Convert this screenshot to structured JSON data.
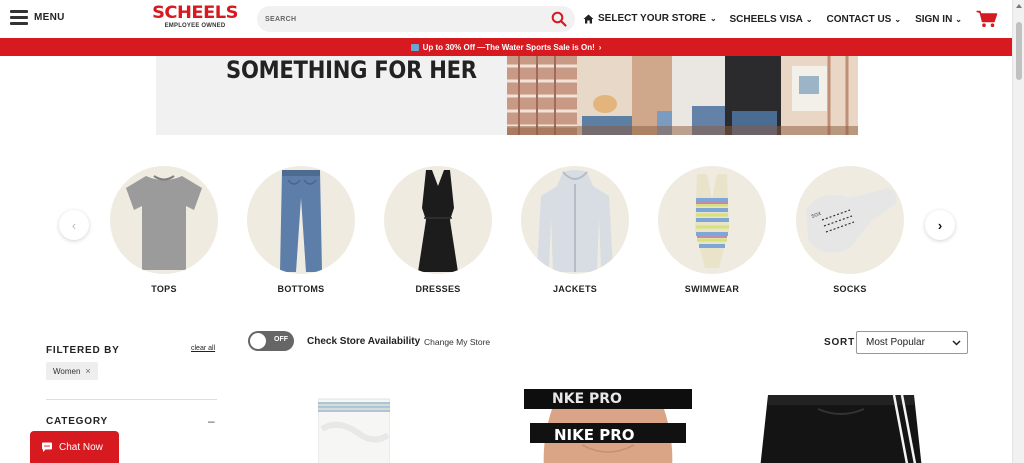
{
  "header": {
    "menu_label": "MENU",
    "logo_main": "SCHEELS",
    "logo_sub": "EMPLOYEE OWNED",
    "search_placeholder": "SEARCH",
    "store_label": "SELECT YOUR STORE",
    "nav": [
      {
        "label": "SCHEELS VISA"
      },
      {
        "label": "CONTACT US"
      },
      {
        "label": "SIGN IN"
      }
    ],
    "brand_red": "#d71920"
  },
  "promo": {
    "text": "Up to 30% Off —The Water Sports Sale is On!",
    "arrow": "›"
  },
  "hero": {
    "title": "SOMETHING FOR HER"
  },
  "categories": [
    {
      "label": "TOPS"
    },
    {
      "label": "BOTTOMS"
    },
    {
      "label": "DRESSES"
    },
    {
      "label": "JACKETS"
    },
    {
      "label": "SWIMWEAR"
    },
    {
      "label": "SOCKS"
    }
  ],
  "filters": {
    "heading": "FILTERED BY",
    "clear_label": "clear all",
    "active_chips": [
      "Women"
    ],
    "category_heading": "CATEGORY",
    "collapse_symbol": "–"
  },
  "toolbar": {
    "toggle_label": "OFF",
    "check_store": "Check Store Availability",
    "change_store": "Change My Store",
    "sort_label": "SORT",
    "sort_value": "Most Popular"
  },
  "products": [
    {
      "type": "towel"
    },
    {
      "type": "sports-bra",
      "print": "NIKE PRO"
    },
    {
      "type": "running-shorts"
    }
  ],
  "chat": {
    "label": "Chat Now"
  }
}
